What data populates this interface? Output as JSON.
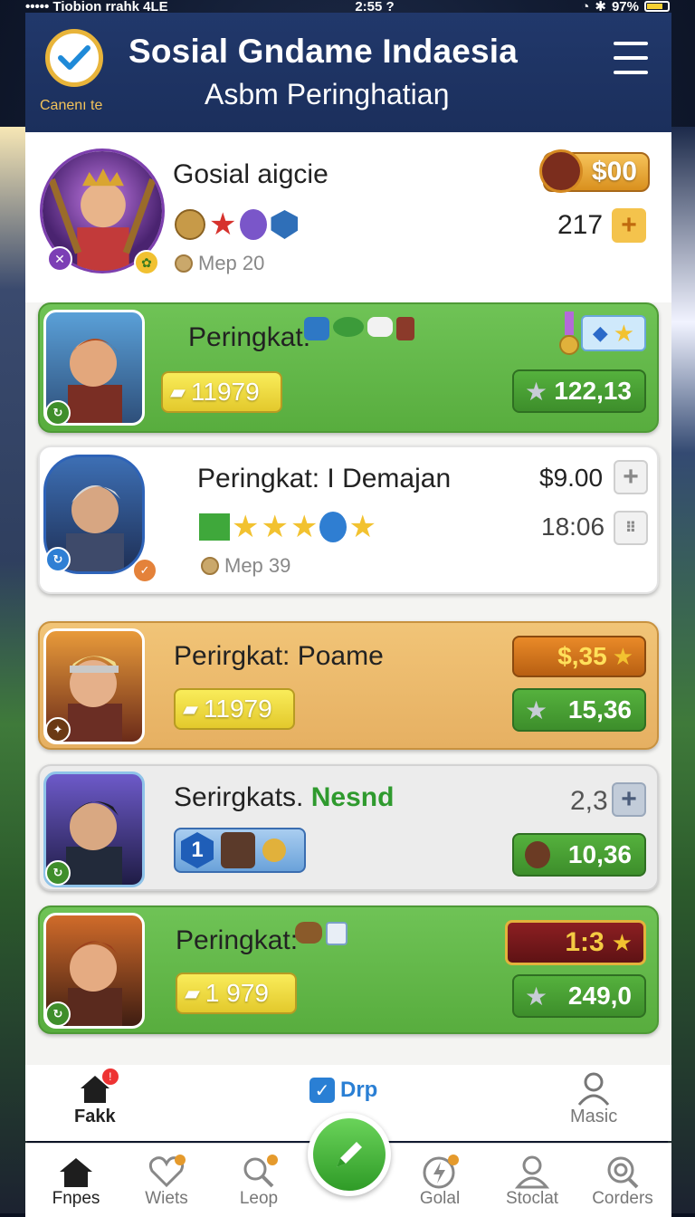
{
  "status_bar": {
    "carrier": "••••• Tiobion rrahk  4LE",
    "time": "2:55 ?",
    "battery": "97%"
  },
  "header": {
    "badge_caption": "Canenı te",
    "title": "Sosial Gndame Indaesia",
    "subtitle": "Asbm Peringhatiaŋ"
  },
  "profile": {
    "name": "Gosial aigcie",
    "meta": "Mep 20",
    "coins": "$00",
    "count": "217",
    "plus": "+"
  },
  "cards": [
    {
      "title": "Peringkat:",
      "score": "11979",
      "rating": "122,13"
    },
    {
      "title": "Peringkat: I Demajan",
      "price": "$9.00",
      "time": "18:06",
      "meta": "Mep 39",
      "plus": "+"
    },
    {
      "title": "Perirgkat: Poame",
      "score": "11979",
      "price": "$,35",
      "rating": "15,36"
    },
    {
      "title_main": "Serirgkats.",
      "title_accent": "Nesnd",
      "value": "2,3",
      "rating": "10,36",
      "plus": "+",
      "shield": "1"
    },
    {
      "title": "Peringkat:",
      "score": "1 979",
      "price": "1:3",
      "rating": "249,0"
    }
  ],
  "sub_tabs": [
    {
      "label": "Fakk"
    },
    {
      "label": "Drp"
    },
    {
      "label": "Masic"
    }
  ],
  "bottom_nav": [
    {
      "label": "Fnpes"
    },
    {
      "label": "Wiets"
    },
    {
      "label": "Leop"
    },
    {
      "label": "Golal"
    },
    {
      "label": "Stoclat"
    },
    {
      "label": "Corders"
    }
  ],
  "colors": {
    "header_bg": "#1b2f5c",
    "green_card": "#5fb545",
    "orange_card": "#e8b366",
    "gold": "#f2c230"
  }
}
